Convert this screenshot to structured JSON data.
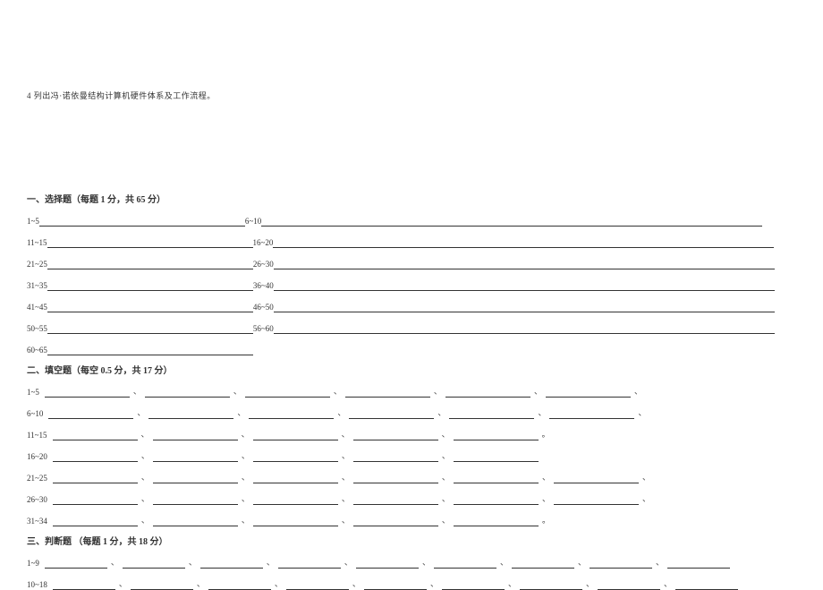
{
  "top_question": "4 列出冯·诺依曼结构计算机硬件体系及工作流程。",
  "section1": {
    "title": "一、选择题（每题 1 分，共 65 分）",
    "rows": [
      {
        "left": "1~5",
        "right": "6~10"
      },
      {
        "left": "11~15",
        "right": "16~20"
      },
      {
        "left": "21~25",
        "right": "26~30"
      },
      {
        "left": "31~35",
        "right": "36~40"
      },
      {
        "left": "41~45",
        "right": "46~50"
      },
      {
        "left": "50~55",
        "right": "56~60"
      },
      {
        "left": "60~65",
        "right": null
      }
    ]
  },
  "section2": {
    "title": "二、填空题（每空 0.5 分，共 17 分）",
    "rows": [
      {
        "label": "1~5",
        "blanks": 6,
        "tail": "、"
      },
      {
        "label": "6~10",
        "blanks": 6,
        "tail": "、"
      },
      {
        "label": "11~15",
        "blanks": 5,
        "tail": "。"
      },
      {
        "label": "16~20",
        "blanks": 5,
        "tail": ""
      },
      {
        "label": "21~25",
        "blanks": 6,
        "tail": "、"
      },
      {
        "label": "26~30",
        "blanks": 6,
        "tail": "、"
      },
      {
        "label": "31~34",
        "blanks": 5,
        "tail": "。"
      }
    ]
  },
  "section3": {
    "title": "三、判断题 （每题 1 分，共 18 分）",
    "rows": [
      {
        "label": "1~9",
        "blanks": 9
      },
      {
        "label": "10~18",
        "blanks": 9
      }
    ]
  }
}
